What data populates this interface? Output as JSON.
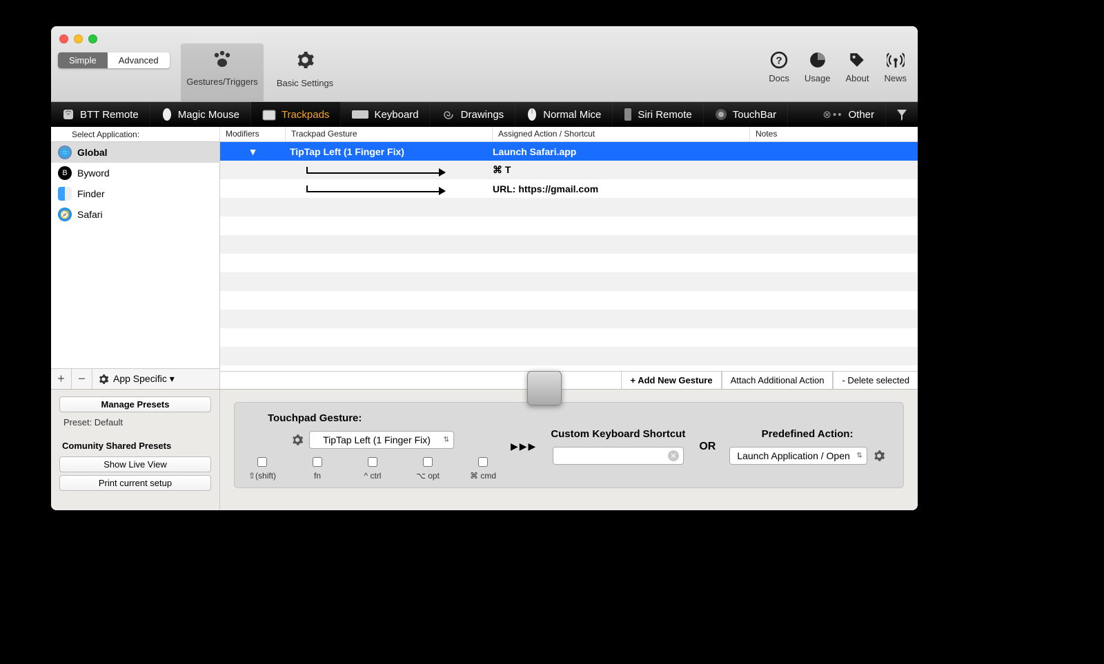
{
  "segmented": {
    "simple": "Simple",
    "advanced": "Advanced",
    "selected": "simple"
  },
  "tool_tabs": {
    "gestures": "Gestures/Triggers",
    "basic": "Basic Settings"
  },
  "right_icons": {
    "docs": "Docs",
    "usage": "Usage",
    "about": "About",
    "news": "News"
  },
  "devices": {
    "btt": "BTT Remote",
    "magic": "Magic Mouse",
    "track": "Trackpads",
    "keyboard": "Keyboard",
    "drawings": "Drawings",
    "normal": "Normal Mice",
    "siri": "Siri Remote",
    "touchbar": "TouchBar",
    "other": "Other"
  },
  "columns": {
    "select_app": "Select Application:",
    "modifiers": "Modifiers",
    "gesture": "Trackpad Gesture",
    "action": "Assigned Action / Shortcut",
    "notes": "Notes"
  },
  "apps": {
    "global": "Global",
    "byword": "Byword",
    "finder": "Finder",
    "safari": "Safari"
  },
  "rows": [
    {
      "gesture": "TipTap Left (1 Finger Fix)",
      "action": "Launch Safari.app",
      "selected": true
    },
    {
      "gesture": "",
      "action": "⌘ T",
      "selected": false,
      "child": true
    },
    {
      "gesture": "",
      "action": "URL: https://gmail.com",
      "selected": false,
      "child": true
    }
  ],
  "sidebar_footer": {
    "app_specific": "App Specific ▾"
  },
  "under_buttons": {
    "add": "+ Add New Gesture",
    "attach": "Attach Additional Action",
    "delete": "- Delete selected"
  },
  "bottom_left": {
    "manage": "Manage Presets",
    "preset_line": "Preset: Default",
    "community_hdr": "Comunity Shared Presets",
    "live": "Show Live View",
    "print": "Print current setup"
  },
  "panel": {
    "touchpad_hdr": "Touchpad Gesture:",
    "gesture_select": "TipTap Left (1 Finger Fix)",
    "mods": {
      "shift": "⇧(shift)",
      "fn": "fn",
      "ctrl": "^ ctrl",
      "opt": "⌥ opt",
      "cmd": "⌘ cmd"
    },
    "shortcut_hdr": "Custom Keyboard Shortcut",
    "or": "OR",
    "predef_hdr": "Predefined Action:",
    "predef_select": "Launch Application / Open"
  }
}
